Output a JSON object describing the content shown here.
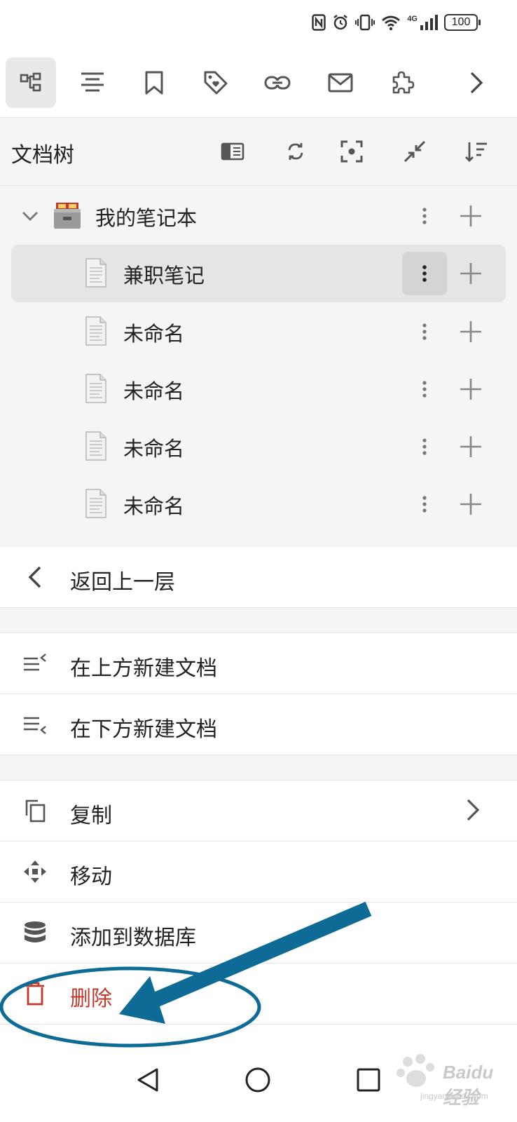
{
  "status_bar": {
    "battery": "100",
    "network": "4G",
    "icons": [
      "nfc-icon",
      "alarm-icon",
      "vibrate-icon",
      "wifi-icon",
      "signal-icon",
      "battery-icon"
    ]
  },
  "toolbar": {
    "items": [
      {
        "icon": "doc-tree-icon",
        "active": true
      },
      {
        "icon": "outline-icon",
        "active": false
      },
      {
        "icon": "bookmark-icon",
        "active": false
      },
      {
        "icon": "tag-icon",
        "active": false
      },
      {
        "icon": "backlink-icon",
        "active": false
      },
      {
        "icon": "inbox-icon",
        "active": false
      },
      {
        "icon": "plugin-icon",
        "active": false
      },
      {
        "icon": "chevron-right-icon",
        "active": false
      }
    ]
  },
  "panel": {
    "title": "文档树",
    "header_icons": [
      "sidebar-icon",
      "refresh-icon",
      "focus-icon",
      "collapse-icon",
      "sort-icon"
    ]
  },
  "tree": {
    "notebook": {
      "label": "我的笔记本",
      "icon": "file-box-icon",
      "expanded": true
    },
    "docs": [
      {
        "label": "兼职笔记",
        "selected": true
      },
      {
        "label": "未命名",
        "selected": false
      },
      {
        "label": "未命名",
        "selected": false
      },
      {
        "label": "未命名",
        "selected": false
      },
      {
        "label": "未命名",
        "selected": false
      }
    ]
  },
  "menu": {
    "back": "返回上一层",
    "new_above": "在上方新建文档",
    "new_below": "在下方新建文档",
    "copy": "复制",
    "move": "移动",
    "add_to_db": "添加到数据库",
    "delete": "删除"
  },
  "colors": {
    "accent": "#0d6b95",
    "danger": "#c0392b",
    "panel_bg": "#f5f5f5"
  },
  "watermark": {
    "text": "Baidu经验",
    "sub": "jingyan.baidu.com"
  }
}
